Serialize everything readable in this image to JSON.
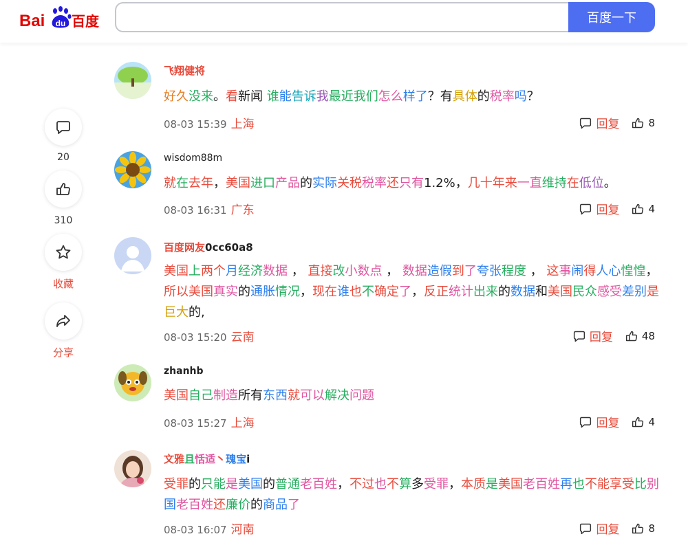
{
  "header": {
    "logo": {
      "left": "Bai",
      "mid": "du",
      "right": "百度"
    },
    "search_value": "",
    "search_button": "百度一下"
  },
  "rail": {
    "comment_count": "20",
    "like_count": "310",
    "favorite_label": "收藏",
    "share_label": "分享"
  },
  "reply_label": "回复",
  "comments": [
    {
      "user": "飞翔健将",
      "segments": [
        {
          "t": "好久",
          "c": "c-org"
        },
        {
          "t": "没来",
          "c": "c-grn"
        },
        {
          "t": "。",
          "c": "c-blk"
        },
        {
          "t": "看",
          "c": "c-red"
        },
        {
          "t": "新闻 ",
          "c": "c-blk"
        },
        {
          "t": "谁",
          "c": "c-grn"
        },
        {
          "t": "能",
          "c": "c-blu"
        },
        {
          "t": "告诉",
          "c": "c-cyn"
        },
        {
          "t": "我",
          "c": "c-pur"
        },
        {
          "t": "最近我们",
          "c": "c-grn"
        },
        {
          "t": "怎么",
          "c": "c-pnk"
        },
        {
          "t": "样了",
          "c": "c-blu"
        },
        {
          "t": "？有",
          "c": "c-blk"
        },
        {
          "t": "具体",
          "c": "c-yel"
        },
        {
          "t": "的",
          "c": "c-blk"
        },
        {
          "t": "税率",
          "c": "c-pnk"
        },
        {
          "t": "吗",
          "c": "c-blu"
        },
        {
          "t": "？",
          "c": "c-blk"
        }
      ],
      "time": "08-03 15:39",
      "location": "上海",
      "likes": "8"
    },
    {
      "user": "wisdom88m",
      "segments": [
        {
          "t": "就",
          "c": "c-red"
        },
        {
          "t": "在",
          "c": "c-grn"
        },
        {
          "t": "去年",
          "c": "c-red"
        },
        {
          "t": "，",
          "c": "c-blk"
        },
        {
          "t": "美国",
          "c": "c-red"
        },
        {
          "t": "进口",
          "c": "c-grn"
        },
        {
          "t": "产品",
          "c": "c-pnk"
        },
        {
          "t": "的",
          "c": "c-blk"
        },
        {
          "t": "实际",
          "c": "c-blu"
        },
        {
          "t": "关税",
          "c": "c-red"
        },
        {
          "t": "税率",
          "c": "c-pnk"
        },
        {
          "t": "还",
          "c": "c-red"
        },
        {
          "t": "只有",
          "c": "c-pnk"
        },
        {
          "t": "1.2%，",
          "c": "c-blk"
        },
        {
          "t": "几十年来",
          "c": "c-red"
        },
        {
          "t": "一直",
          "c": "c-pnk"
        },
        {
          "t": "维持",
          "c": "c-grn"
        },
        {
          "t": "在",
          "c": "c-red"
        },
        {
          "t": "低位",
          "c": "c-pur"
        },
        {
          "t": "。",
          "c": "c-blk"
        }
      ],
      "time": "08-03 16:31",
      "location": "广东",
      "likes": "4"
    },
    {
      "user_parts": [
        {
          "t": "百度网友",
          "c": "c-red"
        },
        {
          "t": "0cc60a8",
          "c": "c-blk"
        }
      ],
      "segments": [
        {
          "t": "美国",
          "c": "c-red"
        },
        {
          "t": "上",
          "c": "c-grn"
        },
        {
          "t": "两个",
          "c": "c-red"
        },
        {
          "t": "月",
          "c": "c-blu"
        },
        {
          "t": "经济",
          "c": "c-grn"
        },
        {
          "t": "数据",
          "c": "c-pnk"
        },
        {
          "t": " ， ",
          "c": "c-blk"
        },
        {
          "t": "直接",
          "c": "c-red"
        },
        {
          "t": "改",
          "c": "c-grn"
        },
        {
          "t": "小数点",
          "c": "c-pnk"
        },
        {
          "t": " ， ",
          "c": "c-blk"
        },
        {
          "t": "数据",
          "c": "c-pnk"
        },
        {
          "t": "造假",
          "c": "c-blu"
        },
        {
          "t": "到",
          "c": "c-red"
        },
        {
          "t": "了",
          "c": "c-pnk"
        },
        {
          "t": "夸张",
          "c": "c-blu"
        },
        {
          "t": "程度",
          "c": "c-grn"
        },
        {
          "t": " ， ",
          "c": "c-blk"
        },
        {
          "t": "这",
          "c": "c-red"
        },
        {
          "t": "事",
          "c": "c-pnk"
        },
        {
          "t": "闹",
          "c": "c-blu"
        },
        {
          "t": "得",
          "c": "c-red"
        },
        {
          "t": "人心",
          "c": "c-blu"
        },
        {
          "t": "惶惶",
          "c": "c-grn"
        },
        {
          "t": "，",
          "c": "c-blk"
        },
        {
          "t": "所以",
          "c": "c-red"
        },
        {
          "t": "美国",
          "c": "c-red"
        },
        {
          "t": "真实",
          "c": "c-pnk"
        },
        {
          "t": "的",
          "c": "c-blk"
        },
        {
          "t": "通胀",
          "c": "c-blu"
        },
        {
          "t": "情况",
          "c": "c-grn"
        },
        {
          "t": "，",
          "c": "c-blk"
        },
        {
          "t": "现在",
          "c": "c-red"
        },
        {
          "t": "谁",
          "c": "c-blu"
        },
        {
          "t": "也",
          "c": "c-red"
        },
        {
          "t": "不",
          "c": "c-grn"
        },
        {
          "t": "确定",
          "c": "c-red"
        },
        {
          "t": "了",
          "c": "c-pnk"
        },
        {
          "t": "，",
          "c": "c-blk"
        },
        {
          "t": "反正",
          "c": "c-red"
        },
        {
          "t": "统计",
          "c": "c-pnk"
        },
        {
          "t": "出来",
          "c": "c-grn"
        },
        {
          "t": "的",
          "c": "c-blk"
        },
        {
          "t": "数据",
          "c": "c-blu"
        },
        {
          "t": "和",
          "c": "c-blk"
        },
        {
          "t": "美国",
          "c": "c-red"
        },
        {
          "t": "民众",
          "c": "c-grn"
        },
        {
          "t": "感受",
          "c": "c-pnk"
        },
        {
          "t": "差别",
          "c": "c-blu"
        },
        {
          "t": "是",
          "c": "c-red"
        },
        {
          "t": "巨大",
          "c": "c-yel"
        },
        {
          "t": "的,",
          "c": "c-blk"
        }
      ],
      "time": "08-03 15:20",
      "location": "云南",
      "likes": "48"
    },
    {
      "user": "zhanhb",
      "segments": [
        {
          "t": "美国",
          "c": "c-red"
        },
        {
          "t": "自己",
          "c": "c-grn"
        },
        {
          "t": "制造",
          "c": "c-pnk"
        },
        {
          "t": "所有",
          "c": "c-blk"
        },
        {
          "t": "东西",
          "c": "c-blu"
        },
        {
          "t": "就",
          "c": "c-red"
        },
        {
          "t": "可以",
          "c": "c-pnk"
        },
        {
          "t": "解决",
          "c": "c-grn"
        },
        {
          "t": "问题",
          "c": "c-pnk"
        }
      ],
      "time": "08-03 15:27",
      "location": "上海",
      "likes": "4"
    },
    {
      "user_parts": [
        {
          "t": "文雅",
          "c": "c-red"
        },
        {
          "t": "且",
          "c": "c-grn"
        },
        {
          "t": "恬适",
          "c": "c-pnk"
        },
        {
          "t": "丶",
          "c": "c-red"
        },
        {
          "t": "瑰宝",
          "c": "c-blu"
        },
        {
          "t": "i",
          "c": "c-blk"
        }
      ],
      "segments": [
        {
          "t": "受罪",
          "c": "c-red"
        },
        {
          "t": "的",
          "c": "c-blk"
        },
        {
          "t": "只能",
          "c": "c-grn"
        },
        {
          "t": "是",
          "c": "c-pnk"
        },
        {
          "t": "美国",
          "c": "c-blu"
        },
        {
          "t": "的",
          "c": "c-blk"
        },
        {
          "t": "普通",
          "c": "c-grn"
        },
        {
          "t": "老百姓",
          "c": "c-pnk"
        },
        {
          "t": "，",
          "c": "c-blk"
        },
        {
          "t": "不过",
          "c": "c-red"
        },
        {
          "t": "也",
          "c": "c-pnk"
        },
        {
          "t": "不",
          "c": "c-red"
        },
        {
          "t": "算",
          "c": "c-grn"
        },
        {
          "t": "多",
          "c": "c-blk"
        },
        {
          "t": "受罪",
          "c": "c-pnk"
        },
        {
          "t": "，",
          "c": "c-blk"
        },
        {
          "t": "本质",
          "c": "c-red"
        },
        {
          "t": "是",
          "c": "c-grn"
        },
        {
          "t": "美国",
          "c": "c-red"
        },
        {
          "t": "老百姓",
          "c": "c-pnk"
        },
        {
          "t": "再",
          "c": "c-blu"
        },
        {
          "t": "也",
          "c": "c-grn"
        },
        {
          "t": "不能",
          "c": "c-red"
        },
        {
          "t": "享受",
          "c": "c-red"
        },
        {
          "t": "比",
          "c": "c-grn"
        },
        {
          "t": "别",
          "c": "c-pnk"
        },
        {
          "t": "国",
          "c": "c-blu"
        },
        {
          "t": "老百姓",
          "c": "c-pnk"
        },
        {
          "t": "还",
          "c": "c-red"
        },
        {
          "t": "廉价",
          "c": "c-grn"
        },
        {
          "t": "的",
          "c": "c-blk"
        },
        {
          "t": "商品",
          "c": "c-blu"
        },
        {
          "t": "了",
          "c": "c-pnk"
        }
      ],
      "time": "08-03 16:07",
      "location": "河南",
      "likes": "8"
    }
  ]
}
